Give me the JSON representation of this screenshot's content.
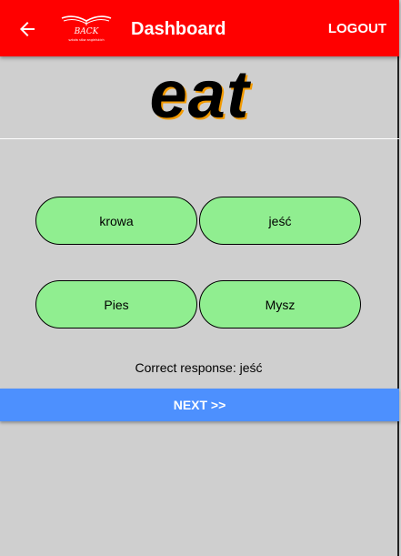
{
  "header": {
    "back_icon": "arrow-left-icon",
    "logo_icon": "open-book-logo",
    "logo_text": "BACK",
    "logo_subtext": "szkoła słów angielskich",
    "title": "Dashboard",
    "logout_label": "LOGOUT",
    "background_color": "#ff0000"
  },
  "quiz": {
    "word": "eat",
    "options": [
      {
        "label": "krowa"
      },
      {
        "label": "jeść"
      },
      {
        "label": "Pies"
      },
      {
        "label": "Mysz"
      }
    ],
    "result_text": "Correct response: jeść",
    "option_color": "#90ee90"
  },
  "footer": {
    "next_label": "NEXT >>",
    "next_color": "#4d90fe"
  }
}
